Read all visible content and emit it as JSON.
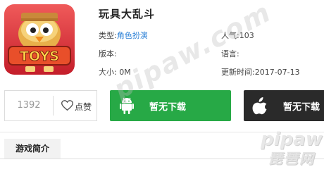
{
  "app": {
    "title": "玩具大乱斗",
    "icon_name": "toys-game-icon",
    "icon_text": "TOYS"
  },
  "info": {
    "type_label": "类型:",
    "type_value": "角色扮演",
    "popularity_label": "人气:",
    "popularity_value": "103",
    "version_label": "版本:",
    "version_value": "",
    "language_label": "语言:",
    "language_value": "",
    "size_label": "大小:",
    "size_value": "0M",
    "updated_label": "更新时间:",
    "updated_value": "2017-07-13"
  },
  "actions": {
    "like_count": "1392",
    "like_label": "点赞",
    "android_label": "暂无下载",
    "ios_label": "暂无下载"
  },
  "tabs": {
    "intro_label": "游戏简介"
  },
  "watermark": {
    "diagonal": "pipaw.com",
    "corner_en": "pipaw",
    "corner_cn": "琵琶网"
  },
  "colors": {
    "android_button": "#27a946",
    "ios_button": "#2a2a2a",
    "link": "#2a7fd6"
  }
}
